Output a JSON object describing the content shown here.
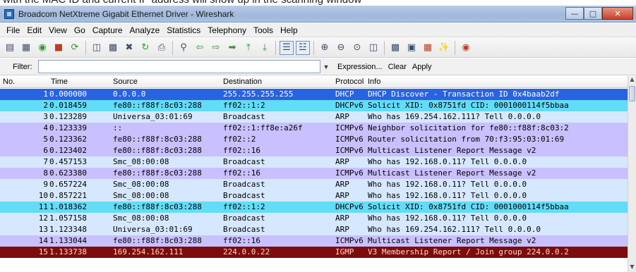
{
  "window": {
    "title": "Broadcom NetXtreme Gigabit Ethernet Driver - Wireshark",
    "top_caption": "with the MAC ID and current IP address will show up in the scanning window"
  },
  "menu": [
    {
      "label": "File"
    },
    {
      "label": "Edit"
    },
    {
      "label": "View"
    },
    {
      "label": "Go"
    },
    {
      "label": "Capture"
    },
    {
      "label": "Analyze"
    },
    {
      "label": "Statistics"
    },
    {
      "label": "Telephony"
    },
    {
      "label": "Tools"
    },
    {
      "label": "Help"
    }
  ],
  "filter": {
    "label": "Filter:",
    "value": "",
    "expression_label": "Expression...",
    "clear_label": "Clear",
    "apply_label": "Apply"
  },
  "columns": {
    "no": "No.",
    "time": "Time",
    "source": "Source",
    "destination": "Destination",
    "protocol": "Protocol",
    "info": "Info"
  },
  "colors": {
    "selected_bg": "#2a63df",
    "selected_fg": "#ffffff",
    "arp_bg": "#d6e8ff",
    "icmpv6_bg": "#c9c0ff",
    "dhcpv6_bg": "#62dcf7",
    "igmp_bg": "#7d0c0c",
    "igmp_fg": "#ffd7c2"
  },
  "packets": [
    {
      "no": "1",
      "time": "0.000000",
      "source": "0.0.0.0",
      "destination": "255.255.255.255",
      "protocol": "DHCP",
      "info": "DHCP Discover - Transaction ID 0x4baab2df",
      "bg": "#2a63df",
      "fg": "#ffffff"
    },
    {
      "no": "2",
      "time": "0.018459",
      "source": "fe80::f88f:8c03:288",
      "destination": "ff02::1:2",
      "protocol": "DHCPv6",
      "info": "Solicit XID: 0x8751fd CID: 0001000114f5bbaa",
      "bg": "#62dcf7",
      "fg": "#000000"
    },
    {
      "no": "3",
      "time": "0.123289",
      "source": "Universa_03:01:69",
      "destination": "Broadcast",
      "protocol": "ARP",
      "info": "Who has 169.254.162.111?  Tell 0.0.0.0",
      "bg": "#d6e8ff",
      "fg": "#000000"
    },
    {
      "no": "4",
      "time": "0.123339",
      "source": "::",
      "destination": "ff02::1:ff8e:a26f",
      "protocol": "ICMPv6",
      "info": "Neighbor solicitation for fe80::f88f:8c03:2",
      "bg": "#c9c0ff",
      "fg": "#000000"
    },
    {
      "no": "5",
      "time": "0.123362",
      "source": "fe80::f88f:8c03:288",
      "destination": "ff02::2",
      "protocol": "ICMPv6",
      "info": "Router solicitation from 70:f3:95:03:01:69",
      "bg": "#c9c0ff",
      "fg": "#000000"
    },
    {
      "no": "6",
      "time": "0.123402",
      "source": "fe80::f88f:8c03:288",
      "destination": "ff02::16",
      "protocol": "ICMPv6",
      "info": "Multicast Listener Report Message v2",
      "bg": "#c9c0ff",
      "fg": "#000000"
    },
    {
      "no": "7",
      "time": "0.457153",
      "source": "Smc_08:00:08",
      "destination": "Broadcast",
      "protocol": "ARP",
      "info": "Who has 192.168.0.11?  Tell 0.0.0.0",
      "bg": "#d6e8ff",
      "fg": "#000000"
    },
    {
      "no": "8",
      "time": "0.623380",
      "source": "fe80::f88f:8c03:288",
      "destination": "ff02::16",
      "protocol": "ICMPv6",
      "info": "Multicast Listener Report Message v2",
      "bg": "#c9c0ff",
      "fg": "#000000"
    },
    {
      "no": "9",
      "time": "0.657224",
      "source": "Smc_08:00:08",
      "destination": "Broadcast",
      "protocol": "ARP",
      "info": "Who has 192.168.0.11?  Tell 0.0.0.0",
      "bg": "#d6e8ff",
      "fg": "#000000"
    },
    {
      "no": "10",
      "time": "0.857221",
      "source": "Smc_08:00:08",
      "destination": "Broadcast",
      "protocol": "ARP",
      "info": "Who has 192.168.0.11?  Tell 0.0.0.0",
      "bg": "#d6e8ff",
      "fg": "#000000"
    },
    {
      "no": "11",
      "time": "1.018362",
      "source": "fe80::f88f:8c03:288",
      "destination": "ff02::1:2",
      "protocol": "DHCPv6",
      "info": "Solicit XID: 0x8751fd CID: 0001000114f5bbaa",
      "bg": "#62dcf7",
      "fg": "#000000"
    },
    {
      "no": "12",
      "time": "1.057158",
      "source": "Smc_08:00:08",
      "destination": "Broadcast",
      "protocol": "ARP",
      "info": "Who has 192.168.0.11?  Tell 0.0.0.0",
      "bg": "#d6e8ff",
      "fg": "#000000"
    },
    {
      "no": "13",
      "time": "1.123348",
      "source": "Universa_03:01:69",
      "destination": "Broadcast",
      "protocol": "ARP",
      "info": "Who has 169.254.162.111?  Tell 0.0.0.0",
      "bg": "#d6e8ff",
      "fg": "#000000"
    },
    {
      "no": "14",
      "time": "1.133044",
      "source": "fe80::f88f:8c03:288",
      "destination": "ff02::16",
      "protocol": "ICMPv6",
      "info": "Multicast Listener Report Message v2",
      "bg": "#c9c0ff",
      "fg": "#000000"
    },
    {
      "no": "15",
      "time": "1.133738",
      "source": "169.254.162.111",
      "destination": "224.0.0.22",
      "protocol": "IGMP",
      "info": "V3 Membership Report / Join group 224.0.0.2",
      "bg": "#7d0c0c",
      "fg": "#ffd7c2"
    }
  ],
  "toolbar_icons": [
    "interface-list-icon",
    "capture-options-icon",
    "start-capture-icon",
    "stop-capture-icon",
    "restart-capture-icon",
    "open-file-icon",
    "save-file-icon",
    "close-file-icon",
    "reload-icon",
    "print-icon",
    "find-packet-icon",
    "go-back-icon",
    "go-forward-icon",
    "go-to-packet-icon",
    "go-first-icon",
    "go-last-icon",
    "colorize-icon",
    "auto-scroll-icon",
    "zoom-in-icon",
    "zoom-out-icon",
    "normal-size-icon",
    "resize-columns-icon",
    "capture-filters-icon",
    "display-filters-icon",
    "coloring-rules-icon",
    "preferences-icon",
    "help-icon"
  ]
}
